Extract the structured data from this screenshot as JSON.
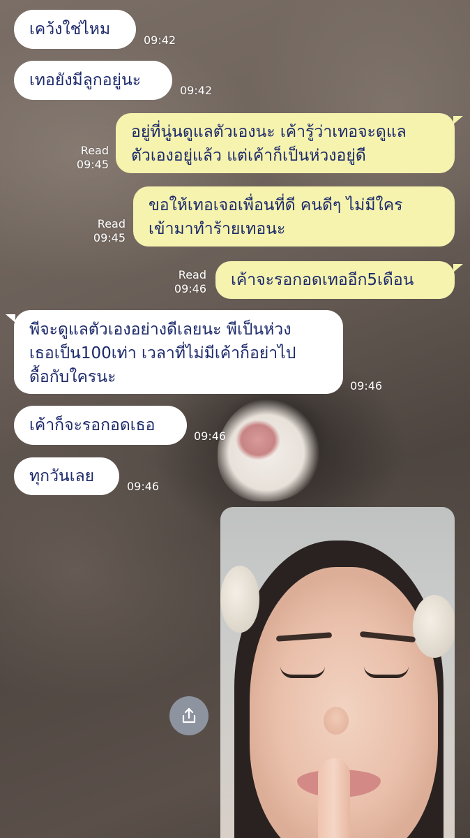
{
  "messages": [
    {
      "text": "เคว้งใช่ไหม",
      "time": "09:42"
    },
    {
      "text": "เทอยังมีลูกอยู่นะ",
      "time": "09:42"
    },
    {
      "line1": "อยู่ที่นู่นดูแลตัวเองนะ เค้ารู้ว่าเทอจะดูแล",
      "line2": "ตัวเองอยู่แล้ว แต่เค้าก็เป็นห่วงอยู่ดี",
      "status": "Read",
      "time": "09:45"
    },
    {
      "line1": "ขอให้เทอเจอเพื่อนที่ดี คนดีๆ ไม่มีใคร",
      "line2": "เข้ามาทำร้ายเทอนะ",
      "status": "Read",
      "time": "09:45"
    },
    {
      "text": "เค้าจะรอกอดเทออีก5เดือน",
      "status": "Read",
      "time": "09:46"
    },
    {
      "line1": "พีจะดูแลตัวเองอย่างดีเลยนะ พีเป็นห่วง",
      "line2": "เธอเป็น100เท่า เวลาที่ไม่มีเค้าก็อย่าไป",
      "line3": "ดื้อกับใครนะ",
      "time": "09:46"
    },
    {
      "text": "เค้าก็จะรอกอดเธอ",
      "time": "09:46"
    },
    {
      "text": "ทุกวันเลย",
      "time": "09:46"
    }
  ],
  "icons": {
    "share": "share-icon"
  },
  "colors": {
    "incoming_bubble": "#ffffff",
    "outgoing_bubble": "#f5f3ae",
    "message_text": "#1d2a6b",
    "meta_text": "#ffffff"
  }
}
